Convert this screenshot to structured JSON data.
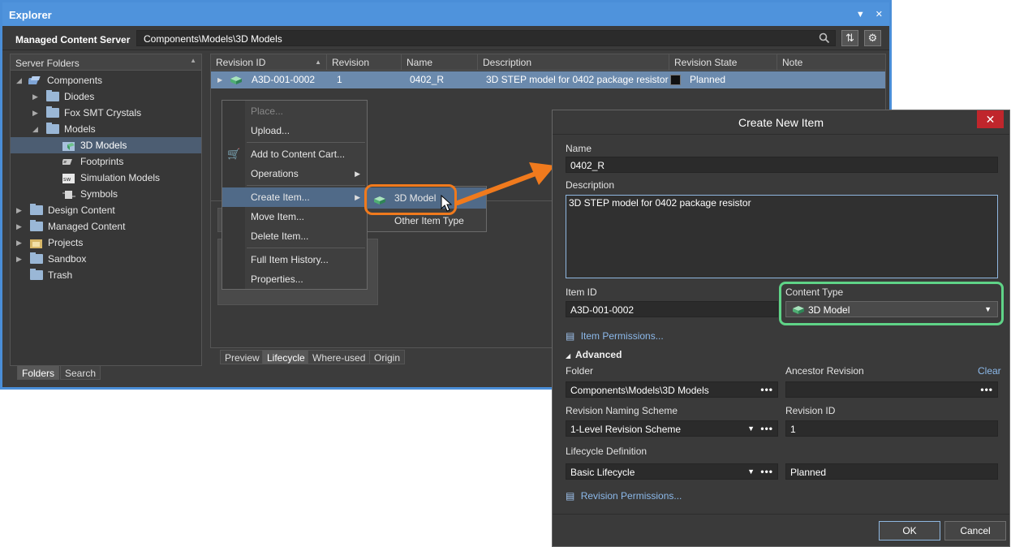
{
  "explorer": {
    "title": "Explorer",
    "server_label": "Managed Content Server",
    "path": "Components\\Models\\3D Models"
  },
  "folders_panel": {
    "header": "Server Folders",
    "tree": [
      {
        "label": "Components"
      },
      {
        "label": "Diodes"
      },
      {
        "label": "Fox SMT Crystals"
      },
      {
        "label": "Models"
      },
      {
        "label": "3D Models"
      },
      {
        "label": "Footprints"
      },
      {
        "label": "Simulation Models"
      },
      {
        "label": "Symbols"
      },
      {
        "label": "Design Content"
      },
      {
        "label": "Managed Content"
      },
      {
        "label": "Projects"
      },
      {
        "label": "Sandbox"
      },
      {
        "label": "Trash"
      }
    ],
    "tabs": [
      "Folders",
      "Search"
    ]
  },
  "grid": {
    "columns": [
      "Revision ID",
      "Revision",
      "Name",
      "Description",
      "Revision State",
      "Note"
    ],
    "row": {
      "revision_id": "A3D-001-0002",
      "revision": "1",
      "name": "0402_R",
      "description": "3D STEP model for 0402 package resistor",
      "state": "Planned",
      "state_color": "#111111"
    },
    "tabs": [
      "Preview",
      "Lifecycle",
      "Where-used",
      "Origin"
    ]
  },
  "context_menu": {
    "items": [
      "Place...",
      "Upload...",
      "Add to Content Cart...",
      "Operations",
      "Create Item...",
      "Move Item...",
      "Delete Item...",
      "Full Item History...",
      "Properties..."
    ],
    "submenu": [
      "3D Model",
      "Other Item Type"
    ]
  },
  "dialog": {
    "title": "Create New Item",
    "name_label": "Name",
    "name_value": "0402_R",
    "description_label": "Description",
    "description_value": "3D STEP model for 0402 package resistor",
    "item_id_label": "Item ID",
    "item_id_value": "A3D-001-0002",
    "content_type_label": "Content Type",
    "content_type_value": "3D Model",
    "item_permissions": "Item Permissions...",
    "advanced": "Advanced",
    "folder_label": "Folder",
    "folder_value": "Components\\Models\\3D Models",
    "ancestor_label": "Ancestor Revision",
    "clear_link": "Clear",
    "naming_label": "Revision Naming Scheme",
    "naming_value": "1-Level Revision Scheme",
    "revision_id_label": "Revision ID",
    "revision_id_value": "1",
    "lifecycle_label": "Lifecycle Definition",
    "lifecycle_value": "Basic Lifecycle",
    "lifecycle_state": "Planned",
    "revision_permissions": "Revision Permissions...",
    "ok": "OK",
    "cancel": "Cancel"
  },
  "colors": {
    "orange_callout": "#f07a1d",
    "green_callout": "#5fd387",
    "window_accent": "#4f93dc",
    "selection": "#6b8aad"
  }
}
